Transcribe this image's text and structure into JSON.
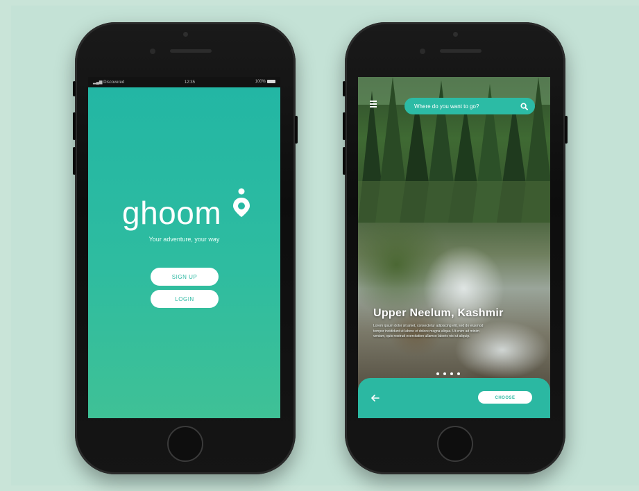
{
  "splash_screen": {
    "status_bar": {
      "carrier": "Discovered",
      "time": "12:35",
      "battery": "100%"
    },
    "logo_text": "ghoom",
    "tagline": "Your adventure, your way",
    "signup_label": "SIGN UP",
    "login_label": "LOGIN"
  },
  "explore_screen": {
    "search": {
      "placeholder": "Where do you want to go?"
    },
    "place_title": "Upper Neelum, Kashmir",
    "place_description": "Lorem ipsum dolor sit amet, consectetur adipiscing elit, sed do eiusmod tempor incididunt ut labore et dolore magna aliqua. Ut enim ad minim veniam, quis nostrud exercitation ullamco laboris nisi ut aliquip.",
    "carousel": {
      "total": 4,
      "active": 1
    },
    "choose_label": "CHOOSE"
  },
  "colors": {
    "brand_teal": "#2bb8a2",
    "background_mint": "#c4e2d6",
    "phone_black": "#111111"
  }
}
